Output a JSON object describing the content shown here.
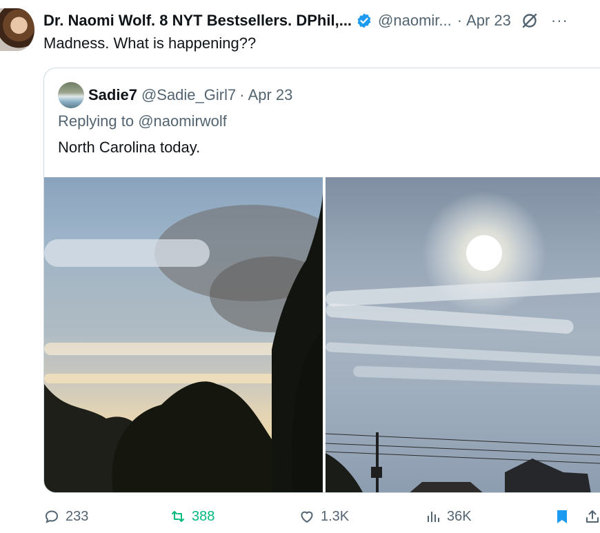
{
  "tweet": {
    "author_name": "Dr. Naomi Wolf. 8 NYT Bestsellers. DPhil,...",
    "handle": "@naomir...",
    "dot": "·",
    "date": "Apr 23",
    "text": "Madness. What is happening??",
    "more": "···"
  },
  "quote": {
    "name": "Sadie7",
    "handle": "@Sadie_Girl7",
    "dot": "·",
    "date": "Apr 23",
    "replying_label": "Replying to",
    "replying_to": "@naomirwolf",
    "text": "North Carolina today."
  },
  "actions": {
    "replies": "233",
    "retweets": "388",
    "likes": "1.3K",
    "views": "36K"
  },
  "colors": {
    "verified": "#1d9bf0",
    "retweet_active": "#00ba7c",
    "bookmark_active": "#1d9bf0",
    "muted": "#536471"
  }
}
